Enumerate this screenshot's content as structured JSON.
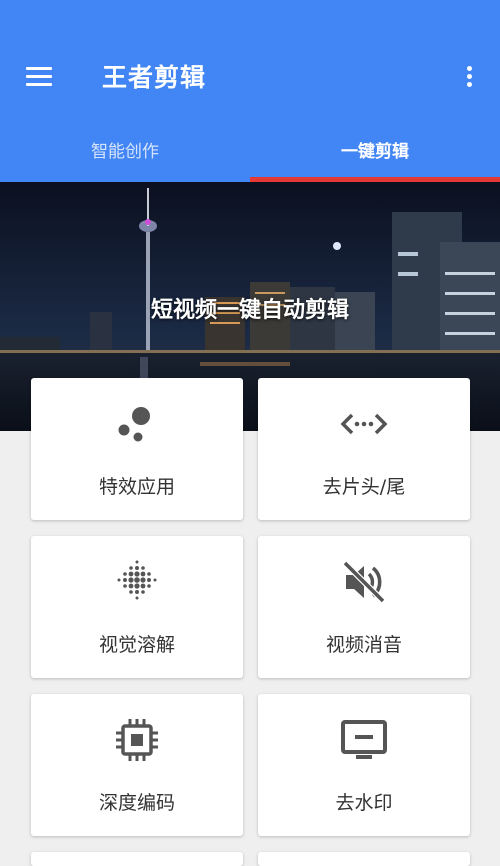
{
  "app": {
    "title": "王者剪辑"
  },
  "header": {
    "menu_icon": "menu-icon",
    "more_icon": "more-vert-icon",
    "color": "#4285f4"
  },
  "tabs": [
    {
      "label": "智能创作",
      "selected": false
    },
    {
      "label": "一键剪辑",
      "selected": true
    }
  ],
  "tab_indicator_color": "#e53935",
  "banner": {
    "text": "短视频一键自动剪辑"
  },
  "features": [
    {
      "label": "特效应用",
      "icon": "bubbles-icon"
    },
    {
      "label": "去片头/尾",
      "icon": "code-arrows-icon"
    },
    {
      "label": "视觉溶解",
      "icon": "blur-dots-icon"
    },
    {
      "label": "视频消音",
      "icon": "volume-off-icon"
    },
    {
      "label": "深度编码",
      "icon": "chip-icon"
    },
    {
      "label": "去水印",
      "icon": "monitor-icon"
    }
  ]
}
